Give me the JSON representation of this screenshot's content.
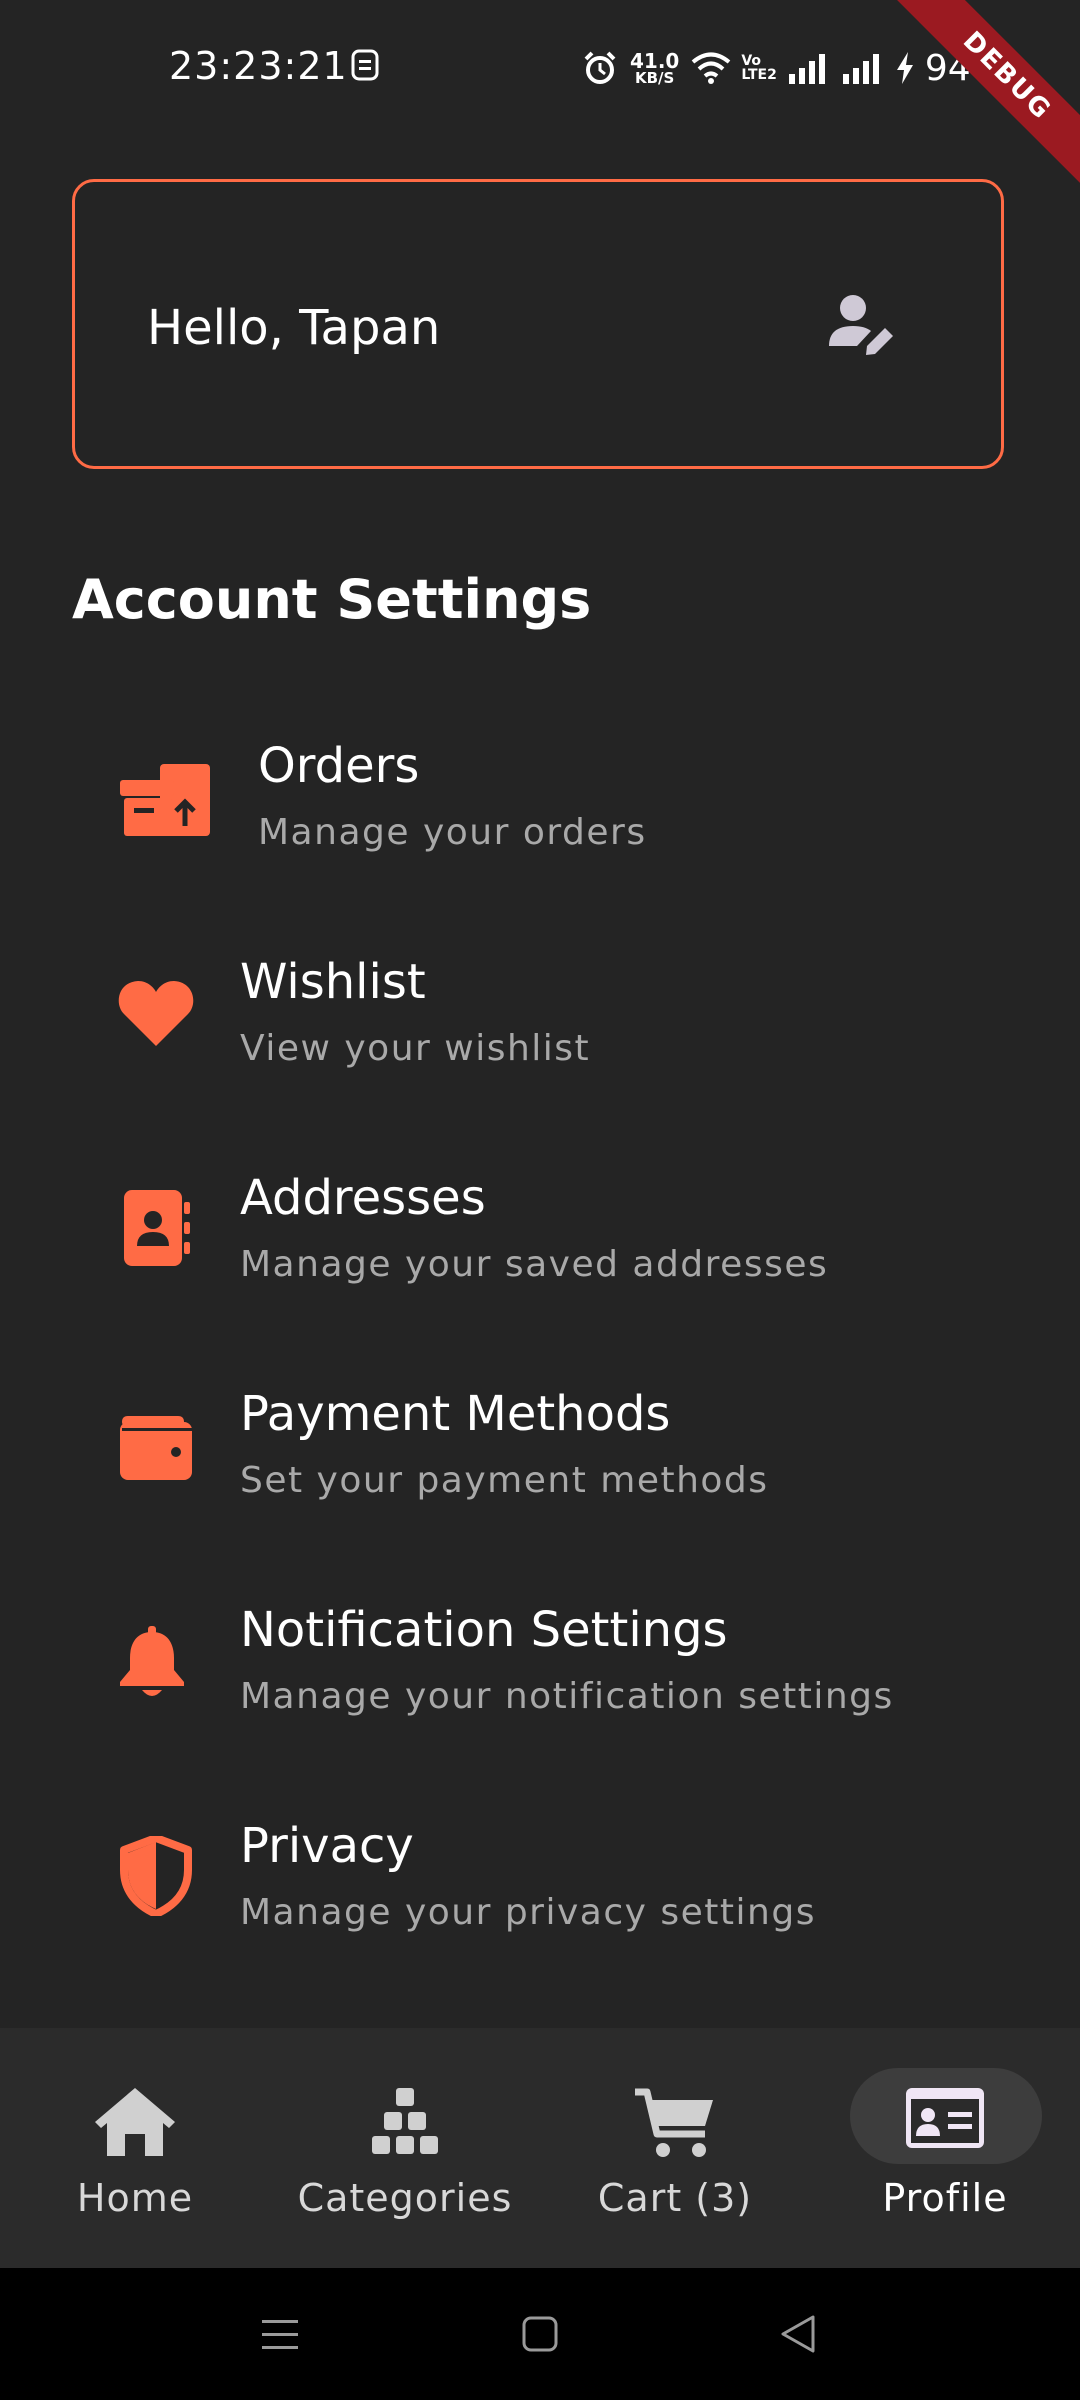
{
  "status_bar": {
    "time": "23:23:21",
    "speed_value": "41.0",
    "speed_unit": "KB/S",
    "volte_top": "Vo",
    "volte_bottom": "LTE2",
    "battery": "94"
  },
  "debug_banner": "DEBUG",
  "greeting": {
    "text": "Hello, Tapan",
    "edit_icon": "user-edit-icon"
  },
  "section_title": "Account Settings",
  "settings_items": [
    {
      "title": "Orders",
      "subtitle": "Manage your orders",
      "icon": "orders-box-icon"
    },
    {
      "title": "Wishlist",
      "subtitle": "View your wishlist",
      "icon": "heart-icon"
    },
    {
      "title": "Addresses",
      "subtitle": "Manage your saved addresses",
      "icon": "address-book-icon"
    },
    {
      "title": "Payment Methods",
      "subtitle": "Set your payment methods",
      "icon": "wallet-icon"
    },
    {
      "title": "Notification Settings",
      "subtitle": "Manage your notification settings",
      "icon": "bell-icon"
    },
    {
      "title": "Privacy",
      "subtitle": "Manage your privacy settings",
      "icon": "shield-icon"
    }
  ],
  "bottom_nav": [
    {
      "label": "Home",
      "icon": "home-icon",
      "active": false
    },
    {
      "label": "Categories",
      "icon": "categories-icon",
      "active": false
    },
    {
      "label": "Cart (3)",
      "icon": "cart-icon",
      "active": false
    },
    {
      "label": "Profile",
      "icon": "profile-card-icon",
      "active": true
    }
  ],
  "colors": {
    "background": "#242424",
    "accent": "#ff6b45",
    "nav_background": "#2b2b2b",
    "active_pill": "#3d3d3d",
    "subtitle": "#a9a9a9"
  }
}
